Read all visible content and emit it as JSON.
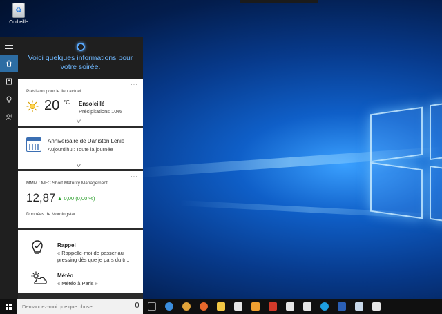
{
  "desktop": {
    "recycle_bin_label": "Corbeille"
  },
  "cortana": {
    "greeting": "Voici quelques informations pour votre soirée.",
    "rail_icons": [
      "hamburger-icon",
      "home-icon",
      "notebook-icon",
      "lightbulb-icon",
      "feedback-icon"
    ],
    "weather": {
      "caption": "Prévision pour le lieu actuel",
      "temperature": "20",
      "unit": "°C",
      "condition": "Ensoleillé",
      "precipitation": "Précipitations 10%"
    },
    "anniversary": {
      "title": "Anniversaire de Daniston Lenie",
      "when": "Aujourd'hui: Toute la journée"
    },
    "stock": {
      "caption": "MMM : MFC Short Maturity Management",
      "price": "12,87",
      "change": "▲ 0,00 (0,00 %)",
      "source": "Données de Morningstar"
    },
    "reminders": [
      {
        "title": "Rappel",
        "text": "« Rappelle-moi de passer au pressing dès que je pars du tr...",
        "icon": "reminder-icon"
      },
      {
        "title": "Météo",
        "text": "« Météo à Paris »",
        "icon": "weather-cloud-icon"
      }
    ],
    "more_label": "···"
  },
  "taskbar": {
    "search_placeholder": "Demandez-moi quelque chose.",
    "apps": [
      {
        "name": "task-view-icon",
        "color": "#9a9a9a"
      },
      {
        "name": "edge-icon",
        "color": "#3b8ede"
      },
      {
        "name": "chrome-icon",
        "color": "#e2a43a"
      },
      {
        "name": "firefox-icon",
        "color": "#e8692c"
      },
      {
        "name": "file-explorer-icon",
        "color": "#f2c744"
      },
      {
        "name": "store-icon",
        "color": "#e6e6e6"
      },
      {
        "name": "calculator-icon",
        "color": "#f0a030"
      },
      {
        "name": "app-red-icon",
        "color": "#d23a2a"
      },
      {
        "name": "mail-icon",
        "color": "#e6e6e6"
      },
      {
        "name": "settings-icon",
        "color": "#e6e6e6"
      },
      {
        "name": "skype-icon",
        "color": "#1e9fe0"
      },
      {
        "name": "word-icon",
        "color": "#2b5fb4"
      },
      {
        "name": "paint-icon",
        "color": "#c8d8e8"
      },
      {
        "name": "snipping-tool-icon",
        "color": "#e6e6e6"
      }
    ]
  },
  "colors": {
    "accent": "#2d6da3",
    "cortana_text": "#6fb8ff",
    "positive": "#2a9d2a"
  }
}
